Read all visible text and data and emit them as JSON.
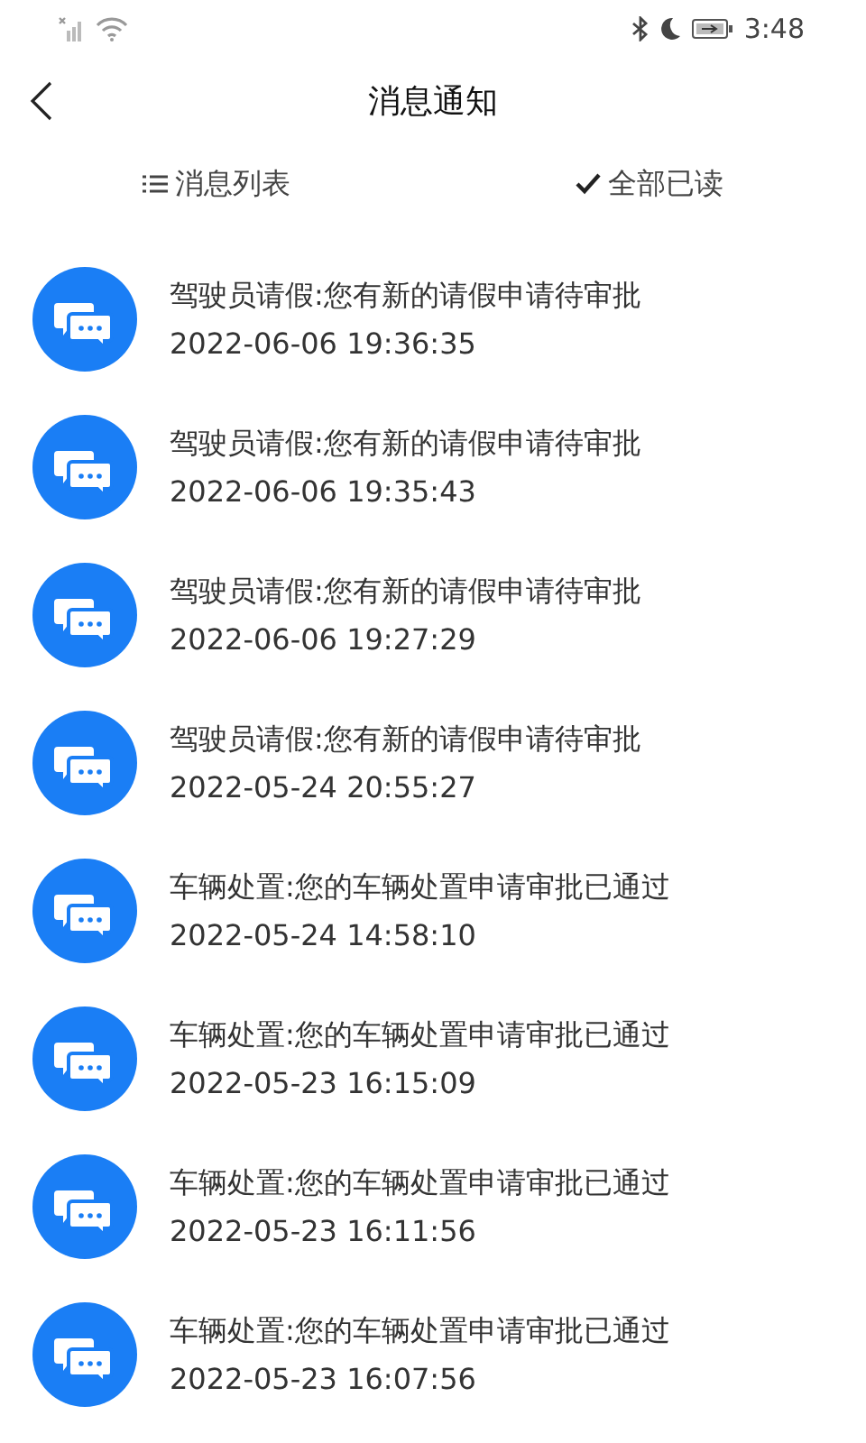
{
  "status_bar": {
    "time": "3:48"
  },
  "header": {
    "title": "消息通知"
  },
  "actions": [
    {
      "kind": "list",
      "label": "消息列表"
    },
    {
      "kind": "check",
      "label": "全部已读"
    }
  ],
  "messages": [
    {
      "title": "驾驶员请假:您有新的请假申请待审批",
      "time": "2022-06-06 19:36:35"
    },
    {
      "title": "驾驶员请假:您有新的请假申请待审批",
      "time": "2022-06-06 19:35:43"
    },
    {
      "title": "驾驶员请假:您有新的请假申请待审批",
      "time": "2022-06-06 19:27:29"
    },
    {
      "title": "驾驶员请假:您有新的请假申请待审批",
      "time": "2022-05-24 20:55:27"
    },
    {
      "title": "车辆处置:您的车辆处置申请审批已通过",
      "time": "2022-05-24 14:58:10"
    },
    {
      "title": "车辆处置:您的车辆处置申请审批已通过",
      "time": "2022-05-23 16:15:09"
    },
    {
      "title": "车辆处置:您的车辆处置申请审批已通过",
      "time": "2022-05-23 16:11:56"
    },
    {
      "title": "车辆处置:您的车辆处置申请审批已通过",
      "time": "2022-05-23 16:07:56"
    }
  ]
}
